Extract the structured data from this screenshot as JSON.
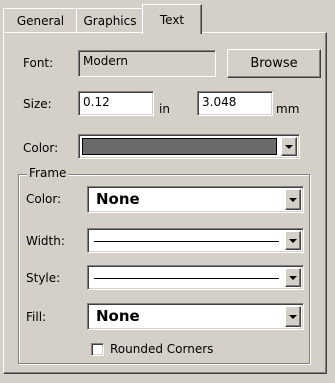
{
  "tabs": [
    {
      "label": "General"
    },
    {
      "label": "Graphics"
    },
    {
      "label": "Text"
    }
  ],
  "font": {
    "label": "Font:",
    "value": "Modern",
    "browse_label": "Browse"
  },
  "size": {
    "label": "Size:",
    "inches_value": "0.12",
    "inches_unit": "in",
    "mm_value": "3.048",
    "mm_unit": "mm"
  },
  "color": {
    "label": "Color:",
    "swatch": "#6b6b6b"
  },
  "frame": {
    "title": "Frame",
    "color_label": "Color:",
    "color_value": "None",
    "width_label": "Width:",
    "style_label": "Style:",
    "fill_label": "Fill:",
    "fill_value": "None",
    "rounded_label": "Rounded Corners",
    "rounded_checked": false
  }
}
